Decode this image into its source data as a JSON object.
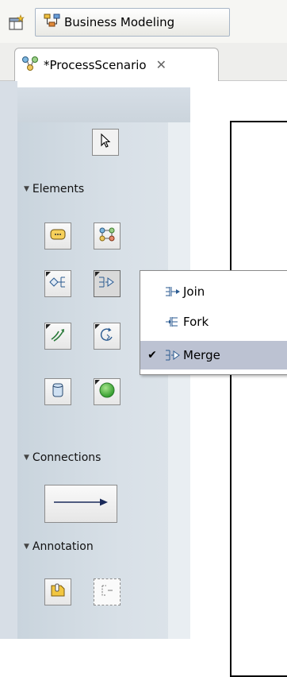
{
  "toolbar": {
    "perspective_label": "Business Modeling"
  },
  "editor": {
    "tab_label": "*ProcessScenario",
    "tab_close": "✕"
  },
  "palette": {
    "sections": [
      {
        "label": "Elements"
      },
      {
        "label": "Connections"
      },
      {
        "label": "Annotation"
      }
    ]
  },
  "dropdown": {
    "items": [
      {
        "label": "Join",
        "checked": false
      },
      {
        "label": "Fork",
        "checked": false
      },
      {
        "label": "Merge",
        "checked": true
      }
    ],
    "check_mark": "✔"
  }
}
